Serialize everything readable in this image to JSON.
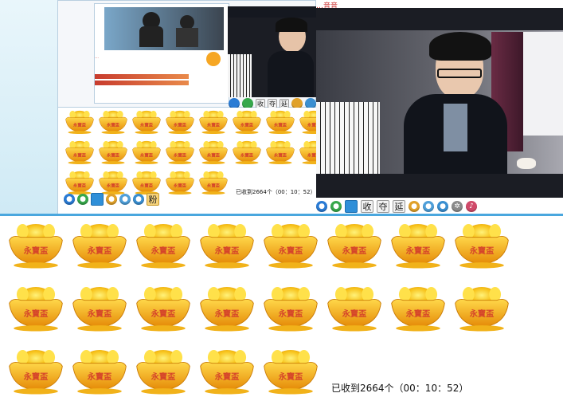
{
  "counter": {
    "main": "已收到2664个（00：10：52）",
    "small": "已收到2664个（00：10：52）"
  },
  "toolbar": {
    "buttons": [
      "收",
      "夺",
      "延"
    ],
    "small_button": "粉"
  },
  "mini_window": {
    "title_fragment": "…音音",
    "small_text": "…"
  },
  "colors": {
    "divider": "#4aa7de",
    "video_bg": "#1b1d24",
    "ingot_gold": "#f5b40f",
    "ingot_red": "#d5442a"
  },
  "icons": [
    "globe-icon",
    "chat-icon",
    "window-icon",
    "people-icon",
    "user-icon",
    "record-icon",
    "gear-icon",
    "sound-icon"
  ]
}
